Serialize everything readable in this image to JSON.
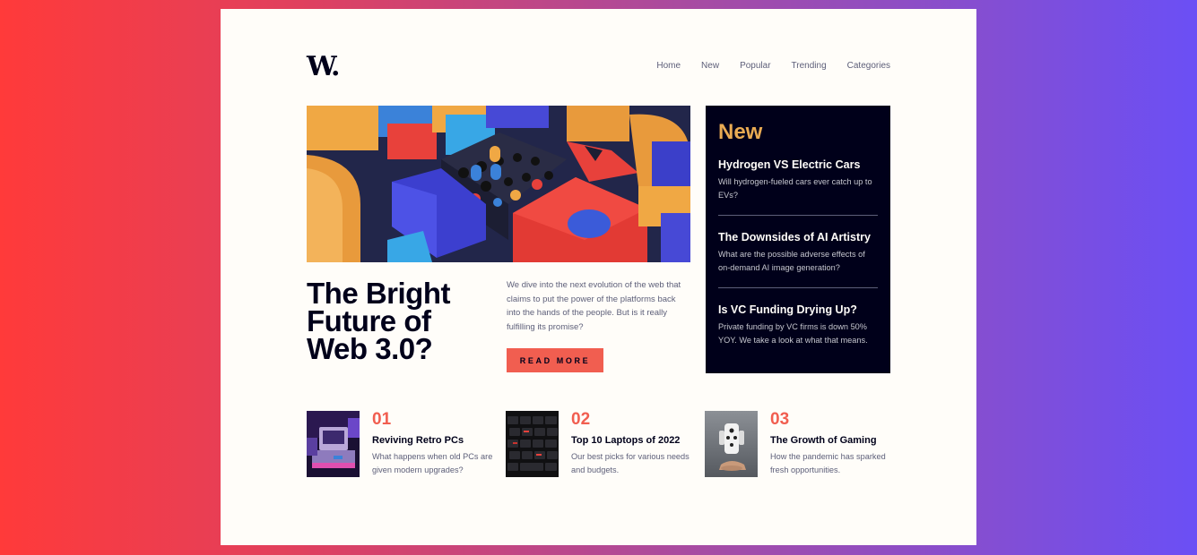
{
  "brand": {
    "logo": "W."
  },
  "nav": {
    "items": [
      "Home",
      "New",
      "Popular",
      "Trending",
      "Categories"
    ]
  },
  "hero": {
    "title": "The Bright Future of Web 3.0?",
    "description": "We dive into the next evolution of the web that claims to put the power of the platforms back into the hands of the people. But is it really fulfilling its promise?",
    "button_label": "READ MORE"
  },
  "new_panel": {
    "title": "New",
    "items": [
      {
        "title": "Hydrogen VS Electric Cars",
        "text": "Will hydrogen-fueled cars ever catch up to EVs?"
      },
      {
        "title": "The Downsides of AI Artistry",
        "text": "What are the possible adverse effects of on-demand AI image generation?"
      },
      {
        "title": "Is VC Funding Drying Up?",
        "text": "Private funding by VC firms is down 50% YOY. We take a look at what that means."
      }
    ]
  },
  "cards": [
    {
      "number": "01",
      "title": "Reviving Retro PCs",
      "text": "What happens when old PCs are given modern upgrades?"
    },
    {
      "number": "02",
      "title": "Top 10 Laptops of 2022",
      "text": "Our best picks for various needs and budgets."
    },
    {
      "number": "03",
      "title": "The Growth of Gaming",
      "text": "How the pandemic has sparked fresh opportunities."
    }
  ],
  "colors": {
    "accent": "#f15e50",
    "dark": "#00001a",
    "gold": "#e9ab53",
    "grey": "#5d5f79",
    "background": "#fffdf9"
  }
}
